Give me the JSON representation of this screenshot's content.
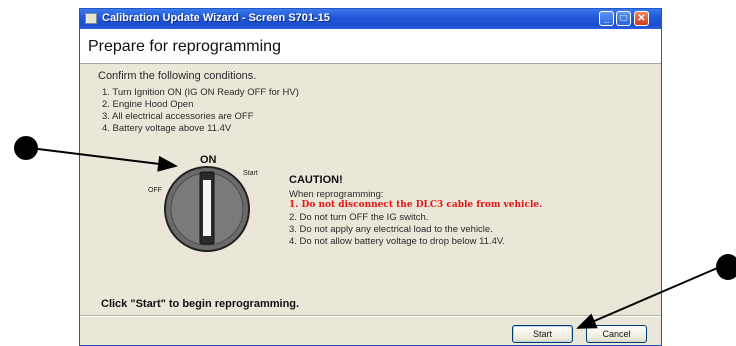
{
  "window": {
    "title": "Calibration Update Wizard - Screen S701-15",
    "buttons": {
      "minimize": "_",
      "maximize": "□",
      "close": "✕"
    }
  },
  "header": {
    "title": "Prepare for reprogramming"
  },
  "instructions": {
    "intro": "Confirm the following conditions.",
    "conditions": [
      "1. Turn Ignition ON (IG ON Ready OFF for HV)",
      "2. Engine Hood Open",
      "3. All electrical accessories are OFF",
      "4. Battery voltage above 11.4V"
    ]
  },
  "key_switch": {
    "on_label": "ON",
    "start_label": "Start",
    "off_label": "OFF"
  },
  "caution": {
    "title": "CAUTION!",
    "intro": "When reprogramming:",
    "items": [
      "1. Do not disconnect the DLC3 cable from vehicle.",
      "2. Do not turn OFF the IG switch.",
      "3. Do not apply any electrical load to the vehicle.",
      "4. Do not allow battery voltage to drop below 11.4V."
    ]
  },
  "footer": {
    "prompt": "Click \"Start\" to begin reprogramming.",
    "start_label": "Start",
    "cancel_label": "Cancel"
  },
  "colors": {
    "titlebar": "#1f55d6",
    "warning": "#e21414",
    "panel": "#eae7d9"
  }
}
